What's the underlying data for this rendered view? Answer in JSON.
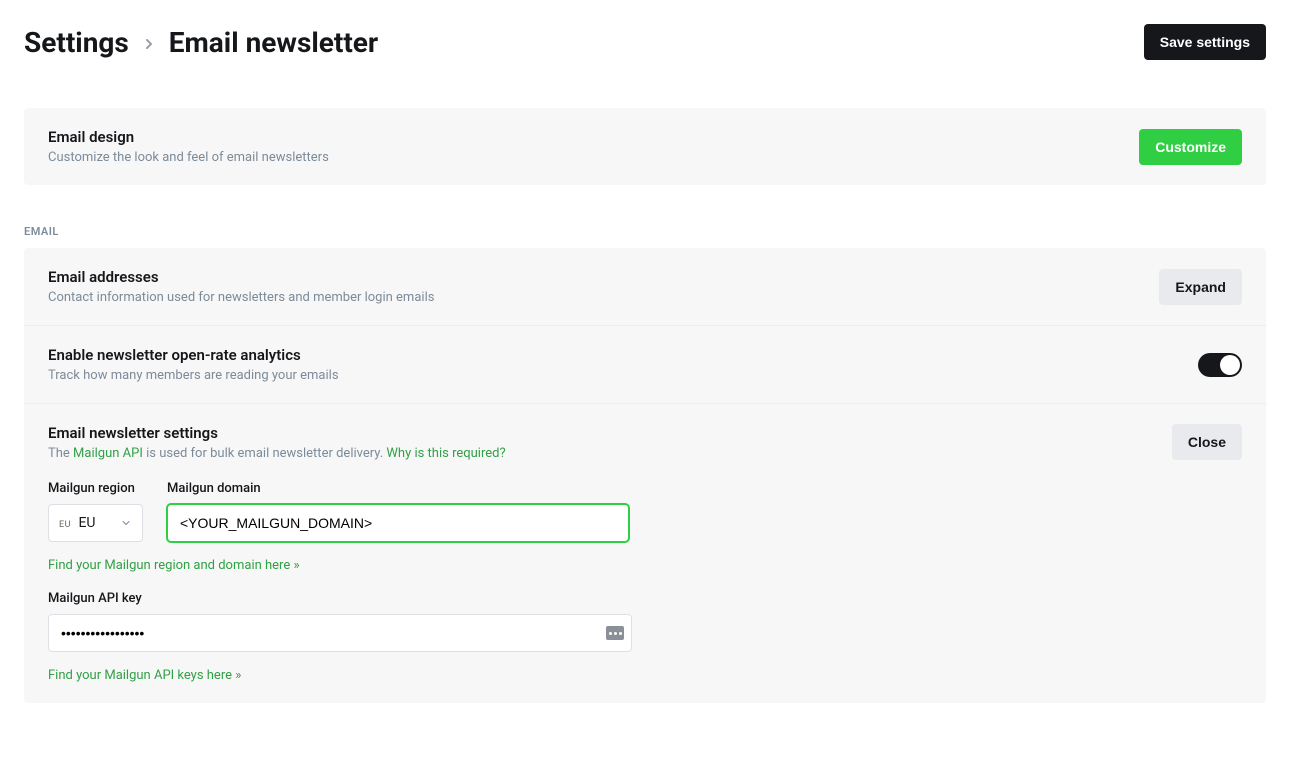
{
  "header": {
    "parent": "Settings",
    "current": "Email newsletter",
    "save_label": "Save settings"
  },
  "design": {
    "title": "Email design",
    "subtitle": "Customize the look and feel of email newsletters",
    "button": "Customize"
  },
  "section_label": "EMAIL",
  "addresses": {
    "title": "Email addresses",
    "subtitle": "Contact information used for newsletters and member login emails",
    "button": "Expand"
  },
  "analytics": {
    "title": "Enable newsletter open-rate analytics",
    "subtitle": "Track how many members are reading your emails",
    "enabled": true
  },
  "newsletter": {
    "title": "Email newsletter settings",
    "subtitle_prefix": "The ",
    "subtitle_link1": "Mailgun API",
    "subtitle_mid": " is used for bulk email newsletter delivery. ",
    "subtitle_link2": "Why is this required?",
    "button": "Close",
    "region_label": "Mailgun region",
    "region_value": "EU",
    "region_flag": "EU",
    "domain_label": "Mailgun domain",
    "domain_value": "<YOUR_MAILGUN_DOMAIN>",
    "region_domain_hint": "Find your Mailgun region and domain here »",
    "apikey_label": "Mailgun API key",
    "apikey_value": "•••••••••••••••••",
    "apikey_hint": "Find your Mailgun API keys here »"
  }
}
